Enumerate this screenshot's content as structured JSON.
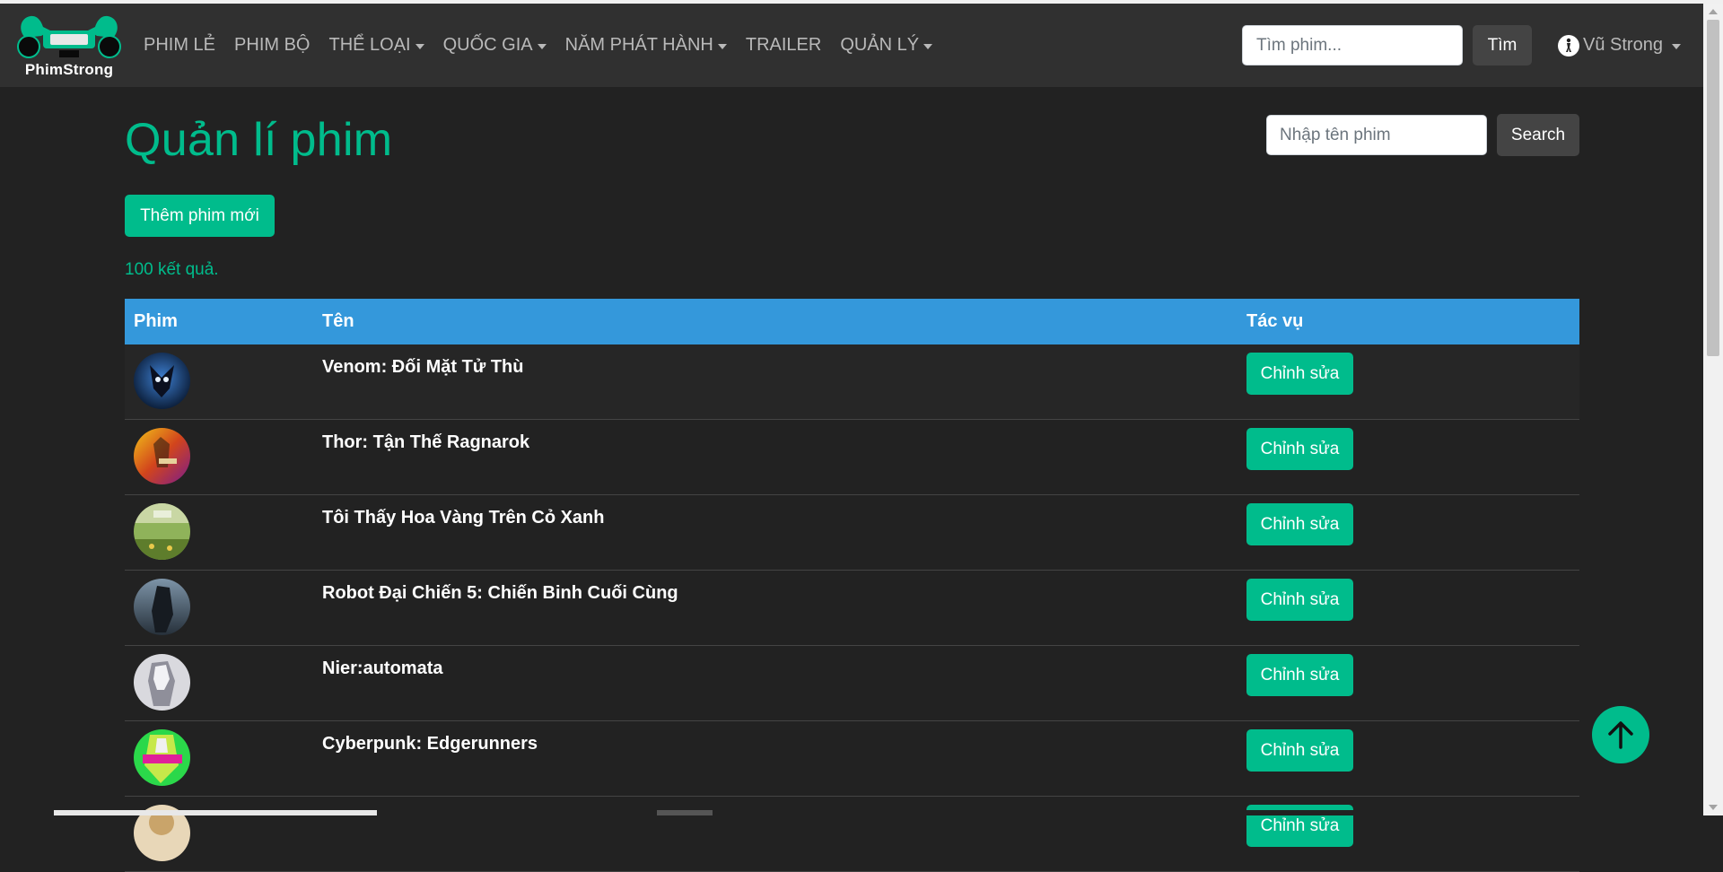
{
  "brand": {
    "name": "PhimStrong",
    "accent": "#00bc8c"
  },
  "nav": {
    "items": [
      {
        "label": "PHIM LẺ",
        "dropdown": false
      },
      {
        "label": "PHIM BỘ",
        "dropdown": false
      },
      {
        "label": "THỂ LOẠI",
        "dropdown": true
      },
      {
        "label": "QUỐC GIA",
        "dropdown": true
      },
      {
        "label": "NĂM PHÁT HÀNH",
        "dropdown": true
      },
      {
        "label": "TRAILER",
        "dropdown": false
      },
      {
        "label": "QUẢN LÝ",
        "dropdown": true
      }
    ],
    "search_placeholder": "Tìm phim...",
    "search_button": "Tìm",
    "user_name": "Vũ Strong"
  },
  "page": {
    "title": "Quản lí phim",
    "search_placeholder": "Nhập tên phim",
    "search_button": "Search",
    "add_button": "Thêm phim mới",
    "result_count": "100 kết quả."
  },
  "table": {
    "headers": {
      "film": "Phim",
      "name": "Tên",
      "action": "Tác vụ"
    },
    "edit_label": "Chỉnh sửa",
    "rows": [
      {
        "name": "Venom: Đối Mặt Tử Thù"
      },
      {
        "name": "Thor: Tận Thế Ragnarok"
      },
      {
        "name": "Tôi Thấy Hoa Vàng Trên Cỏ Xanh"
      },
      {
        "name": "Robot Đại Chiến 5: Chiến Binh Cuối Cùng"
      },
      {
        "name": "Nier:automata"
      },
      {
        "name": "Cyberpunk: Edgerunners"
      },
      {
        "name": ""
      }
    ]
  },
  "colors": {
    "header": "#3498db",
    "background": "#222222",
    "navbar": "#303030"
  }
}
